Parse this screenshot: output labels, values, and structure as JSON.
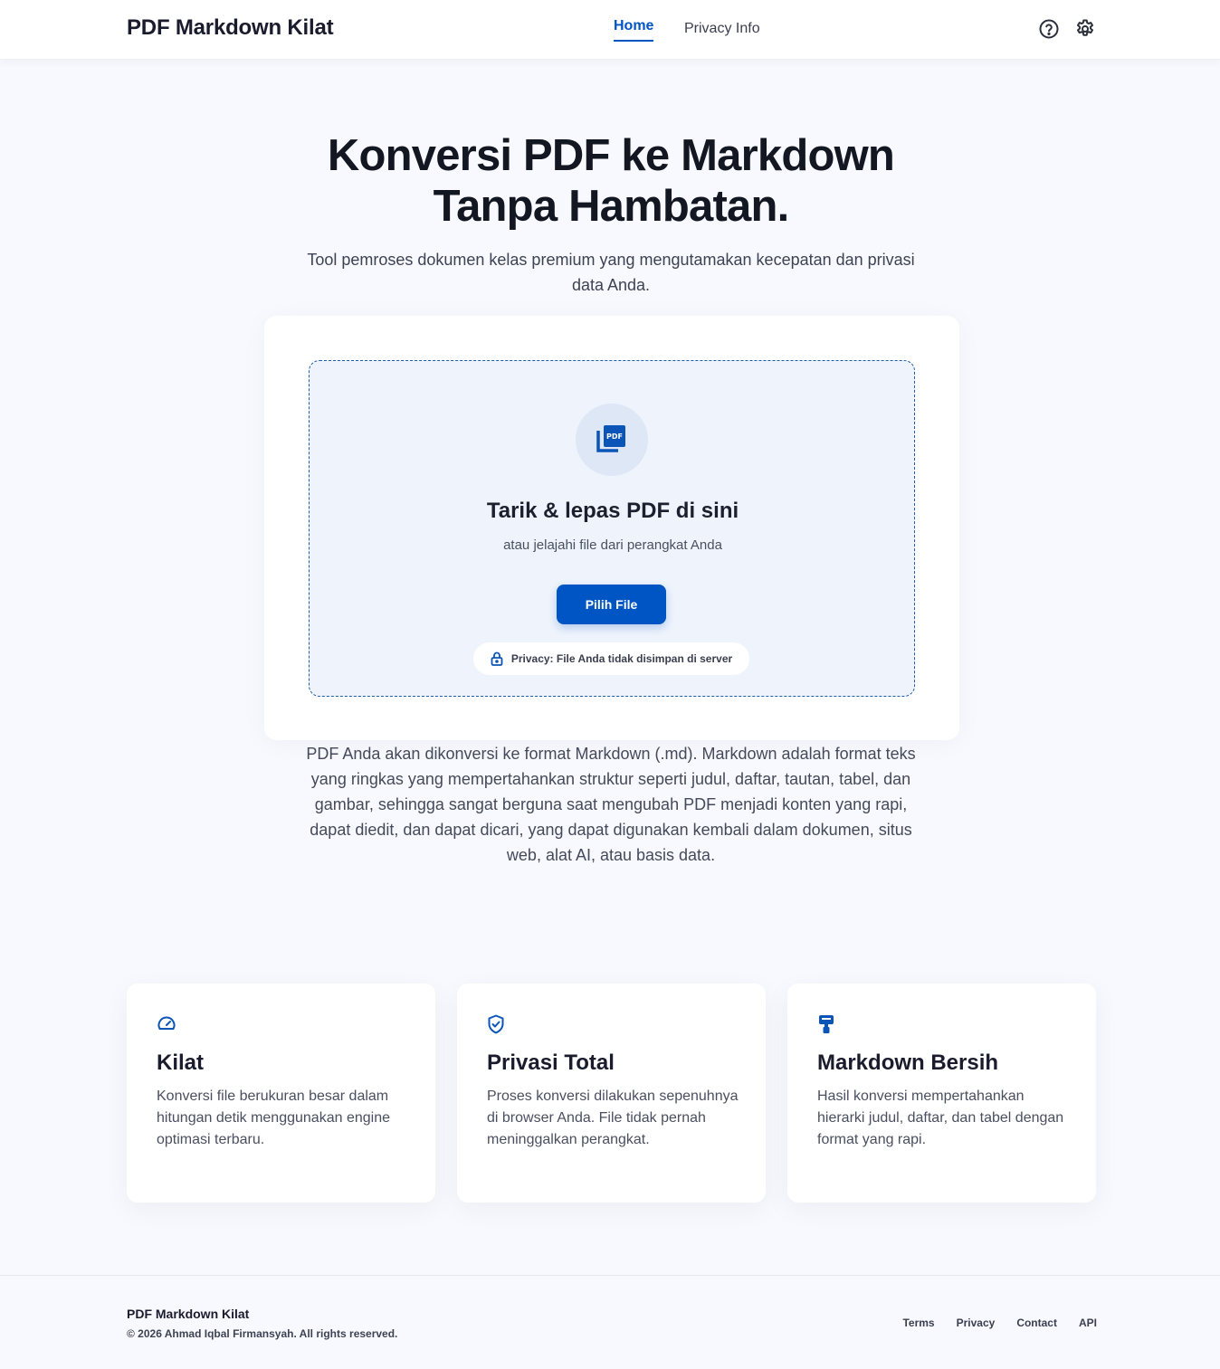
{
  "header": {
    "brand": "PDF Markdown Kilat",
    "nav": [
      {
        "label": "Home",
        "active": true
      },
      {
        "label": "Privacy Info",
        "active": false
      }
    ],
    "icons": [
      "help-icon",
      "gear-icon"
    ]
  },
  "hero": {
    "title_line1": "Konversi PDF ke Markdown",
    "title_line2": "Tanpa Hambatan.",
    "subtitle": "Tool pemroses dokumen kelas premium yang mengutamakan kecepatan dan privasi data Anda."
  },
  "upload": {
    "icon": "pdf-file-icon",
    "icon_text": "PDF",
    "title": "Tarik & lepas PDF di sini",
    "subtitle": "atau jelajahi file dari perangkat Anda",
    "button": "Pilih File",
    "privacy_note": "Privacy: File Anda tidak disimpan di server"
  },
  "description": "PDF Anda akan dikonversi ke format Markdown (.md). Markdown adalah format teks yang ringkas yang mempertahankan struktur seperti judul, daftar, tautan, tabel, dan gambar, sehingga sangat berguna saat mengubah PDF menjadi konten yang rapi, dapat diedit, dan dapat dicari, yang dapat digunakan kembali dalam dokumen, situs web, alat AI, atau basis data.",
  "features": [
    {
      "icon": "speedometer-icon",
      "title": "Kilat",
      "text": "Konversi file berukuran besar dalam hitungan detik menggunakan engine optimasi terbaru."
    },
    {
      "icon": "shield-check-icon",
      "title": "Privasi Total",
      "text": "Proses konversi dilakukan sepenuhnya di browser Anda. File tidak pernah meninggalkan perangkat."
    },
    {
      "icon": "paint-roller-icon",
      "title": "Markdown Bersih",
      "text": "Hasil konversi mempertahankan hierarki judul, daftar, dan tabel dengan format yang rapi."
    }
  ],
  "footer": {
    "brand": "PDF Markdown Kilat",
    "copyright": "© 2026 Ahmad Iqbal Firmansyah. All rights reserved.",
    "links": [
      "Terms",
      "Privacy",
      "Contact",
      "API"
    ]
  },
  "colors": {
    "accent": "#0055c4",
    "background": "#f8f9fe",
    "dropzone": "#eff4fc"
  }
}
